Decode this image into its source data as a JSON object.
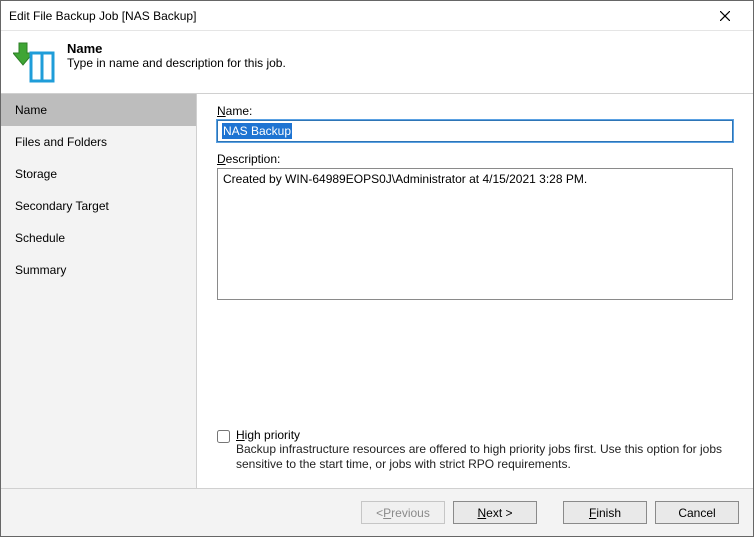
{
  "window": {
    "title": "Edit File Backup Job [NAS Backup]"
  },
  "header": {
    "heading": "Name",
    "sub": "Type in name and description for this job."
  },
  "sidebar": {
    "items": [
      {
        "label": "Name",
        "active": true
      },
      {
        "label": "Files and Folders",
        "active": false
      },
      {
        "label": "Storage",
        "active": false
      },
      {
        "label": "Secondary Target",
        "active": false
      },
      {
        "label": "Schedule",
        "active": false
      },
      {
        "label": "Summary",
        "active": false
      }
    ]
  },
  "form": {
    "name_label_pre": "N",
    "name_label_rest": "ame:",
    "name_value": "NAS Backup",
    "desc_label_pre": "D",
    "desc_label_rest": "escription:",
    "desc_value": "Created by WIN-64989EOPS0J\\Administrator at 4/15/2021 3:28 PM.",
    "priority_pre": "H",
    "priority_rest": "igh priority",
    "priority_help": "Backup infrastructure resources are offered to high priority jobs first. Use this option for jobs sensitive to the start time, or jobs with strict RPO requirements.",
    "priority_checked": false
  },
  "footer": {
    "previous_pre": "< ",
    "previous_ul": "P",
    "previous_rest": "revious",
    "next_pre": "",
    "next_ul": "N",
    "next_rest": "ext >",
    "finish_pre": "",
    "finish_ul": "F",
    "finish_rest": "inish",
    "cancel": "Cancel"
  }
}
